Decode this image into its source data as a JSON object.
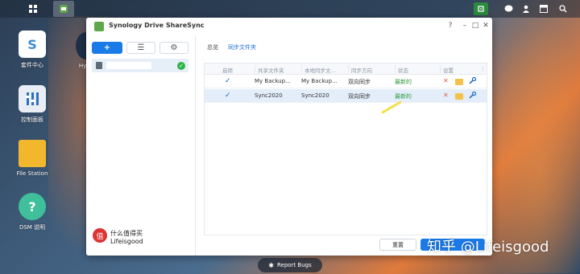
{
  "taskbar": {
    "icons": [
      "grid-icon",
      "drive-app-icon",
      "synology-drive-icon",
      "chat-icon",
      "user-icon",
      "widgets-icon",
      "search-icon"
    ]
  },
  "desktop": {
    "icons": [
      {
        "label": "套件中心"
      },
      {
        "label": "控制面板"
      },
      {
        "label": "File Station"
      },
      {
        "label": "DSM 说明"
      },
      {
        "label": "Hype"
      }
    ]
  },
  "window": {
    "title": "Synology Drive ShareSync",
    "controls": {
      "help": "?",
      "minimize": "–",
      "maximize": "□",
      "close": "✕"
    },
    "left_panel": {
      "add_label": "+",
      "list_label": "☰",
      "gear_label": "⚙",
      "item_check": "✓"
    },
    "tabs": [
      {
        "label": "总览",
        "active": false
      },
      {
        "label": "同步文件夹",
        "active": true
      }
    ],
    "table": {
      "headers": [
        "启用",
        "共享文件夹",
        "本地同步文...",
        "同步方向",
        "状态",
        "设置"
      ],
      "rows": [
        {
          "enabled": "✓",
          "shared": "My Backup...",
          "local": "My Backup...",
          "direction": "双向同步",
          "status": "最新的"
        },
        {
          "enabled": "✓",
          "shared": "Sync2020",
          "local": "Sync2020",
          "direction": "双向同步",
          "status": "最新的"
        }
      ]
    },
    "buttons": {
      "reset": "重置",
      "apply": ""
    }
  },
  "watermark": {
    "seal": "值",
    "line1": "什么值得买",
    "line2": "Lifeisgood"
  },
  "report_bugs": {
    "label": "Report Bugs"
  },
  "zhihu": {
    "text": "知乎 @Lifeisgood"
  }
}
